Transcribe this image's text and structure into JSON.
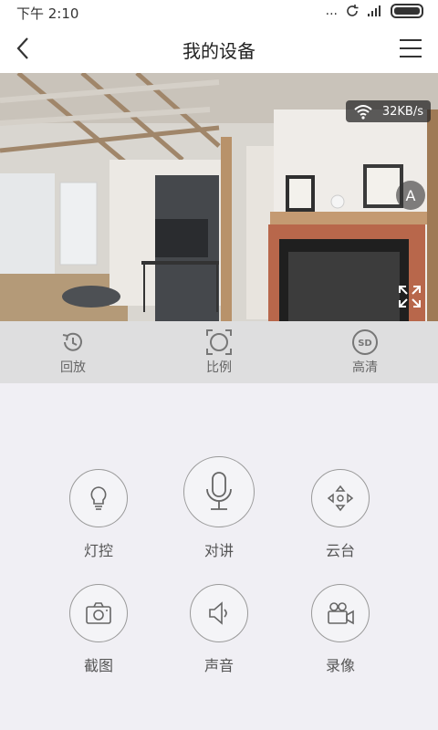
{
  "status": {
    "time": "下午 2:10",
    "dots": "..."
  },
  "header": {
    "title": "我的设备"
  },
  "video": {
    "speed": "32KB/s",
    "auto_label": "A"
  },
  "toolbar": {
    "playback": "回放",
    "ratio": "比例",
    "hd": "高清",
    "sd_icon": "SD"
  },
  "controls": {
    "light": "灯控",
    "talk": "对讲",
    "ptz": "云台",
    "screenshot": "截图",
    "sound": "声音",
    "record": "录像"
  }
}
